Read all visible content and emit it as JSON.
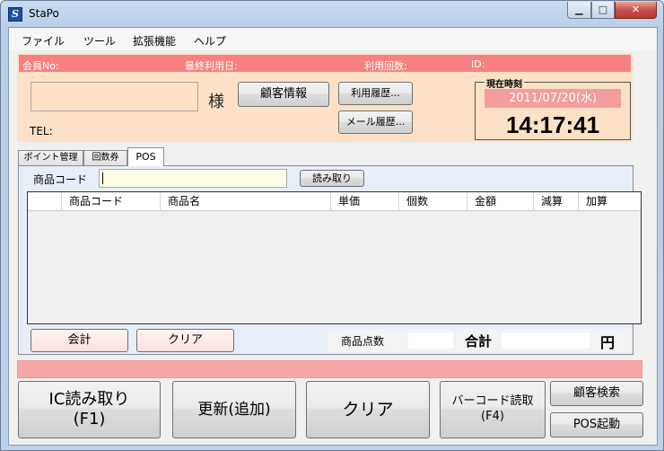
{
  "window": {
    "title": "StaPo",
    "icon_letter": "S",
    "controls": {
      "minimize": "▁",
      "maximize": "□",
      "close": "✕"
    }
  },
  "menu": [
    "ファイル",
    "ツール",
    "拡張機能",
    "ヘルプ"
  ],
  "member_bar": {
    "member_no": "会員No:",
    "last_use": "最終利用日:",
    "use_count": "利用回数:",
    "id": "ID:"
  },
  "customer": {
    "name_value": "",
    "honorific": "様",
    "tel_label": "TEL:",
    "info_button": "顧客情報",
    "history_button": "利用履歴...",
    "mail_button": "メール履歴..."
  },
  "clock": {
    "legend": "現在時刻",
    "date": "2011/07/20(水)",
    "time": "14:17:41"
  },
  "tabs": [
    {
      "label": "ポイント管理"
    },
    {
      "label": "回数券"
    },
    {
      "label": "POS",
      "active": true
    }
  ],
  "pos": {
    "code_label": "商品コード",
    "code_value": "",
    "read_button": "読み取り",
    "columns": [
      "",
      "商品コード",
      "商品名",
      "単価",
      "個数",
      "金額",
      "減算",
      "加算"
    ],
    "rows": [],
    "pay_button": "会計",
    "clear_button": "クリア",
    "item_count_label": "商品点数",
    "item_count_value": "",
    "total_label": "合計",
    "total_value": "",
    "currency": "円"
  },
  "status_text": "",
  "actions": {
    "ic_read": [
      "IC読み取り",
      "(F1)"
    ],
    "update": "更新(追加)",
    "clear": "クリア",
    "barcode": [
      "バーコード読取",
      "(F4)"
    ],
    "search": "顧客検索",
    "pos_start": "POS起動"
  },
  "colors": {
    "member_bar": "#f88080",
    "info_panel": "#fde1c6",
    "status_bar": "#f7a6a6",
    "code_input": "#fefde6",
    "date_box": "#f49d9d"
  }
}
